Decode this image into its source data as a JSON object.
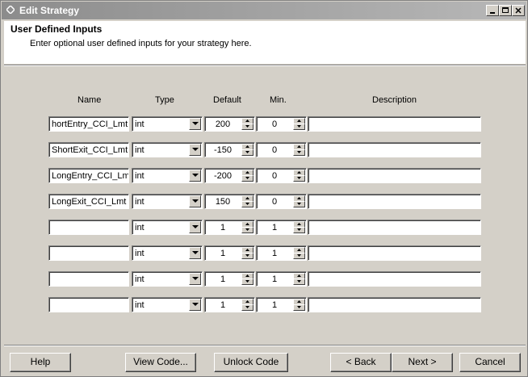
{
  "window": {
    "title": "Edit Strategy"
  },
  "header": {
    "title": "User Defined Inputs",
    "description": "Enter optional user defined inputs for your strategy here."
  },
  "columns": {
    "name": "Name",
    "type": "Type",
    "default": "Default",
    "min": "Min.",
    "description": "Description"
  },
  "rows": [
    {
      "name": "hortEntry_CCI_Lmt",
      "type": "int",
      "default": "200",
      "min": "0",
      "description": ""
    },
    {
      "name": "ShortExit_CCI_Lmt",
      "type": "int",
      "default": "-150",
      "min": "0",
      "description": ""
    },
    {
      "name": "LongEntry_CCI_Lmt",
      "type": "int",
      "default": "-200",
      "min": "0",
      "description": ""
    },
    {
      "name": "LongExit_CCI_Lmt",
      "type": "int",
      "default": "150",
      "min": "0",
      "description": ""
    },
    {
      "name": "",
      "type": "int",
      "default": "1",
      "min": "1",
      "description": ""
    },
    {
      "name": "",
      "type": "int",
      "default": "1",
      "min": "1",
      "description": ""
    },
    {
      "name": "",
      "type": "int",
      "default": "1",
      "min": "1",
      "description": ""
    },
    {
      "name": "",
      "type": "int",
      "default": "1",
      "min": "1",
      "description": ""
    }
  ],
  "buttons": {
    "help": "Help",
    "view_code": "View Code...",
    "unlock_code": "Unlock Code",
    "back": "< Back",
    "next": "Next >",
    "cancel": "Cancel"
  }
}
